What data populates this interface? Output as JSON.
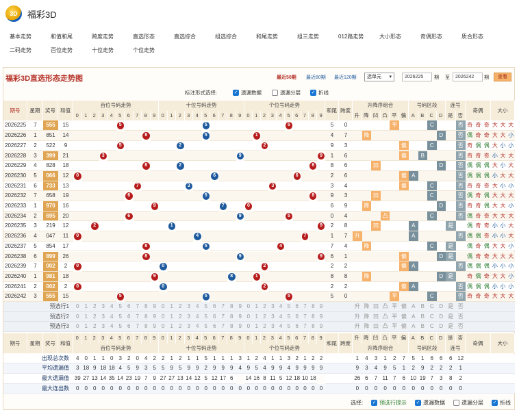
{
  "app": {
    "title": "福彩3D",
    "logo_text": "3D"
  },
  "nav": [
    "基本走势",
    "和值和尾",
    "跨度走势",
    "直选形态",
    "直选综合",
    "组选综合",
    "和尾走势",
    "组三走势",
    "012路走势",
    "大小形态",
    "奇偶形态",
    "质合形态",
    "二码走势",
    "百位走势",
    "十位走势",
    "个位走势"
  ],
  "chart_title": "福彩3D直选形态走势图",
  "period_links": {
    "p50": "最近50期",
    "p80": "最近80期",
    "p120": "最近120期"
  },
  "range_select": "选单元",
  "date_from": "2026225",
  "period_label1": "期",
  "to_label": "至",
  "date_to": "2026242",
  "period_label2": "期",
  "query_btn": "查看",
  "mark_style": {
    "label": "标注形式选择:",
    "options": [
      {
        "label": "遗漏数据",
        "checked": true
      },
      {
        "label": "遗漏分层",
        "checked": false
      },
      {
        "label": "折线",
        "checked": true
      }
    ]
  },
  "headers": {
    "issue": "期号",
    "week": "星期",
    "prize": "奖号",
    "sum": "和值",
    "hundreds": "百位号码走势",
    "tens": "十位号码走势",
    "units": "个位号码走势",
    "sumtail": "和尾",
    "span": "跨度",
    "pattern": "升降序组合",
    "zone": "号码区段",
    "consec": "连号",
    "oddeven": "奇偶",
    "bigsmall": "大小",
    "pattern_cols": [
      "升",
      "降",
      "凹",
      "凸",
      "平",
      "偏"
    ],
    "zone_cols": [
      "A",
      "B",
      "C",
      "D"
    ],
    "consec_cols": [
      "是",
      "否"
    ],
    "digits": [
      "0",
      "1",
      "2",
      "3",
      "4",
      "5",
      "6",
      "7",
      "8",
      "9"
    ]
  },
  "rows": [
    {
      "issue": "2026225",
      "week": "7",
      "prize": "555",
      "sum": "15",
      "tail": "5",
      "span": "0",
      "h": "5",
      "t": "5",
      "u": "5",
      "pat": "平",
      "zone": "C",
      "cons": "否",
      "oe": [
        "奇",
        "奇",
        "奇"
      ],
      "bs": [
        "大",
        "大",
        "大"
      ]
    },
    {
      "issue": "2026226",
      "week": "1",
      "prize": "851",
      "sum": "14",
      "tail": "4",
      "span": "7",
      "h": "8",
      "t": "5",
      "u": "1",
      "pat": "降",
      "zone": "D",
      "cons": "否",
      "oe": [
        "偶",
        "奇",
        "奇"
      ],
      "bs": [
        "大",
        "大",
        "小"
      ]
    },
    {
      "issue": "2026227",
      "week": "2",
      "prize": "522",
      "sum": "9",
      "tail": "9",
      "span": "3",
      "h": "5",
      "t": "2",
      "u": "2",
      "pat": "偏",
      "zone": "C",
      "cons": "否",
      "oe": [
        "奇",
        "偶",
        "偶"
      ],
      "bs": [
        "大",
        "小",
        "小"
      ]
    },
    {
      "issue": "2026228",
      "week": "3",
      "prize": "399",
      "sum": "21",
      "tail": "1",
      "span": "6",
      "h": "3",
      "t": "9",
      "u": "9",
      "pat": "偏",
      "zone": "B",
      "cons": "否",
      "oe": [
        "奇",
        "奇",
        "奇"
      ],
      "bs": [
        "小",
        "大",
        "大"
      ]
    },
    {
      "issue": "2026229",
      "week": "4",
      "prize": "828",
      "sum": "18",
      "tail": "8",
      "span": "6",
      "h": "8",
      "t": "2",
      "u": "8",
      "pat": "凹",
      "zone": "D",
      "cons": "否",
      "oe": [
        "偶",
        "偶",
        "偶"
      ],
      "bs": [
        "大",
        "小",
        "大"
      ]
    },
    {
      "issue": "2026230",
      "week": "5",
      "prize": "066",
      "sum": "12",
      "tail": "2",
      "span": "6",
      "h": "0",
      "t": "6",
      "u": "6",
      "pat": "偏",
      "zone": "A",
      "cons": "否",
      "oe": [
        "偶",
        "偶",
        "偶"
      ],
      "bs": [
        "小",
        "大",
        "大"
      ]
    },
    {
      "issue": "2026231",
      "week": "6",
      "prize": "733",
      "sum": "13",
      "tail": "3",
      "span": "4",
      "h": "7",
      "t": "3",
      "u": "3",
      "pat": "偏",
      "zone": "C",
      "cons": "否",
      "oe": [
        "奇",
        "奇",
        "奇"
      ],
      "bs": [
        "大",
        "小",
        "小"
      ]
    },
    {
      "issue": "2026232",
      "week": "7",
      "prize": "658",
      "sum": "19",
      "tail": "9",
      "span": "3",
      "h": "6",
      "t": "5",
      "u": "8",
      "pat": "凹",
      "zone": "C",
      "cons": "否",
      "oe": [
        "偶",
        "奇",
        "偶"
      ],
      "bs": [
        "大",
        "大",
        "大"
      ]
    },
    {
      "issue": "2026233",
      "week": "1",
      "prize": "970",
      "sum": "16",
      "tail": "6",
      "span": "9",
      "h": "9",
      "t": "7",
      "u": "0",
      "pat": "降",
      "zone": "D",
      "cons": "否",
      "oe": [
        "奇",
        "奇",
        "偶"
      ],
      "bs": [
        "大",
        "大",
        "小"
      ]
    },
    {
      "issue": "2026234",
      "week": "2",
      "prize": "695",
      "sum": "20",
      "tail": "0",
      "span": "4",
      "h": "6",
      "t": "9",
      "u": "5",
      "pat": "凸",
      "zone": "C",
      "cons": "否",
      "oe": [
        "偶",
        "奇",
        "奇"
      ],
      "bs": [
        "大",
        "大",
        "大"
      ]
    },
    {
      "issue": "2026235",
      "week": "3",
      "prize": "219",
      "sum": "12",
      "tail": "2",
      "span": "8",
      "h": "2",
      "t": "1",
      "u": "9",
      "pat": "凹",
      "zone": "A",
      "cons": "是",
      "oe": [
        "偶",
        "奇",
        "奇"
      ],
      "bs": [
        "小",
        "小",
        "大"
      ]
    },
    {
      "issue": "2026236",
      "week": "4",
      "prize": "047",
      "sum": "11",
      "tail": "1",
      "span": "7",
      "h": "0",
      "t": "4",
      "u": "7",
      "pat": "升",
      "zone": "A",
      "cons": "否",
      "oe": [
        "偶",
        "偶",
        "奇"
      ],
      "bs": [
        "小",
        "小",
        "大"
      ]
    },
    {
      "issue": "2026237",
      "week": "5",
      "prize": "854",
      "sum": "17",
      "tail": "7",
      "span": "4",
      "h": "8",
      "t": "5",
      "u": "4",
      "pat": "降",
      "zone": "C",
      "cons": "是",
      "oe": [
        "偶",
        "奇",
        "偶"
      ],
      "bs": [
        "大",
        "大",
        "小"
      ]
    },
    {
      "issue": "2026238",
      "week": "6",
      "prize": "899",
      "sum": "26",
      "tail": "6",
      "span": "1",
      "h": "8",
      "t": "9",
      "u": "9",
      "pat": "偏",
      "zone": "D",
      "cons": "是",
      "oe": [
        "偶",
        "奇",
        "奇"
      ],
      "bs": [
        "大",
        "大",
        "大"
      ]
    },
    {
      "issue": "2026239",
      "week": "7",
      "prize": "002",
      "sum": "2",
      "tail": "2",
      "span": "2",
      "h": "0",
      "t": "0",
      "u": "2",
      "pat": "偏",
      "zone": "A",
      "cons": "否",
      "oe": [
        "偶",
        "偶",
        "偶"
      ],
      "bs": [
        "小",
        "小",
        "小"
      ]
    },
    {
      "issue": "2026240",
      "week": "1",
      "prize": "981",
      "sum": "18",
      "tail": "8",
      "span": "8",
      "h": "9",
      "t": "8",
      "u": "1",
      "pat": "降",
      "zone": "D",
      "cons": "是",
      "oe": [
        "奇",
        "偶",
        "奇"
      ],
      "bs": [
        "大",
        "大",
        "小"
      ]
    },
    {
      "issue": "2026241",
      "week": "2",
      "prize": "002",
      "sum": "2",
      "tail": "2",
      "span": "2",
      "h": "0",
      "t": "0",
      "u": "2",
      "pat": "偏",
      "zone": "A",
      "cons": "否",
      "oe": [
        "偶",
        "偶",
        "偶"
      ],
      "bs": [
        "小",
        "小",
        "小"
      ]
    },
    {
      "issue": "2026242",
      "week": "3",
      "prize": "555",
      "sum": "15",
      "tail": "5",
      "span": "0",
      "h": "5",
      "t": "5",
      "u": "5",
      "pat": "平",
      "zone": "C",
      "cons": "否",
      "oe": [
        "奇",
        "奇",
        "奇"
      ],
      "bs": [
        "大",
        "大",
        "大"
      ]
    }
  ],
  "predict_rows": [
    "预选行1",
    "预选行2",
    "预选行3"
  ],
  "stats": [
    {
      "label": "出现总次数",
      "h": [
        "4",
        "0",
        "1",
        "1",
        "0",
        "3",
        "2",
        "0",
        "4",
        "2"
      ],
      "t": [
        "2",
        "1",
        "2",
        "1",
        "1",
        "5",
        "1",
        "1",
        "1",
        "3"
      ],
      "u": [
        "1",
        "2",
        "4",
        "1",
        "1",
        "3",
        "2",
        "1",
        "2",
        "2"
      ],
      "pat": [
        "1",
        "4",
        "3",
        "1",
        "2",
        "7"
      ],
      "zone": [
        "5",
        "1",
        "6",
        "6"
      ],
      "cons": [
        "6",
        "12"
      ]
    },
    {
      "label": "平均遗漏值",
      "h": [
        "3",
        "18",
        "9",
        "18",
        "18",
        "4",
        "5",
        "9",
        "3",
        "5"
      ],
      "t": [
        "5",
        "9",
        "5",
        "9",
        "9",
        "2",
        "9",
        "9",
        "9",
        "4"
      ],
      "u": [
        "9",
        "5",
        "4",
        "9",
        "9",
        "4",
        "9",
        "9",
        "9",
        "9"
      ],
      "pat": [
        "9",
        "3",
        "4",
        "9",
        "5",
        "1"
      ],
      "zone": [
        "2",
        "9",
        "2",
        "2"
      ],
      "cons": [
        "2",
        "1"
      ]
    },
    {
      "label": "最大遗漏值",
      "h": [
        "39",
        "27",
        "13",
        "14",
        "35",
        "14",
        "23",
        "19",
        "7",
        "9"
      ],
      "t": [
        "27",
        "27",
        "13",
        "14",
        "12",
        "5",
        "12",
        "17",
        "6"
      ],
      "u": [
        "14",
        "16",
        "8",
        "11",
        "5",
        "12",
        "18",
        "10",
        "18"
      ],
      "pat": [
        "26",
        "6",
        "7",
        "11",
        "7",
        "6"
      ],
      "zone": [
        "10",
        "19",
        "7",
        "3"
      ],
      "cons": [
        "8",
        "2"
      ]
    },
    {
      "label": "最大连出数",
      "h": [
        "0",
        "0",
        "0",
        "0",
        "0",
        "0",
        "0",
        "0",
        "0",
        "0"
      ],
      "t": [
        "0",
        "0",
        "0",
        "0",
        "0",
        "0",
        "0",
        "0",
        "0",
        "0"
      ],
      "u": [
        "0",
        "0",
        "0",
        "0",
        "0",
        "0",
        "0",
        "0",
        "0",
        "0"
      ],
      "pat": [
        "0",
        "0",
        "0",
        "0",
        "0",
        "0"
      ],
      "zone": [
        "0",
        "0",
        "0",
        "0"
      ],
      "cons": [
        "0",
        "0"
      ]
    }
  ],
  "footer": {
    "label": "选择:",
    "options": [
      {
        "label": "预选行提示",
        "checked": true,
        "color": "#2e7d32"
      },
      {
        "label": "遗漏数据",
        "checked": true
      },
      {
        "label": "遗漏分层",
        "checked": false
      },
      {
        "label": "折线",
        "checked": true
      }
    ]
  },
  "colors": {
    "red_ball": "#b71c1c",
    "blue_ball": "#1e5a9e",
    "header_bg": "#f5ecd9",
    "accent": "#b5342a",
    "pattern_mark": "#f6b26b",
    "zone_mark": "#78909c"
  }
}
